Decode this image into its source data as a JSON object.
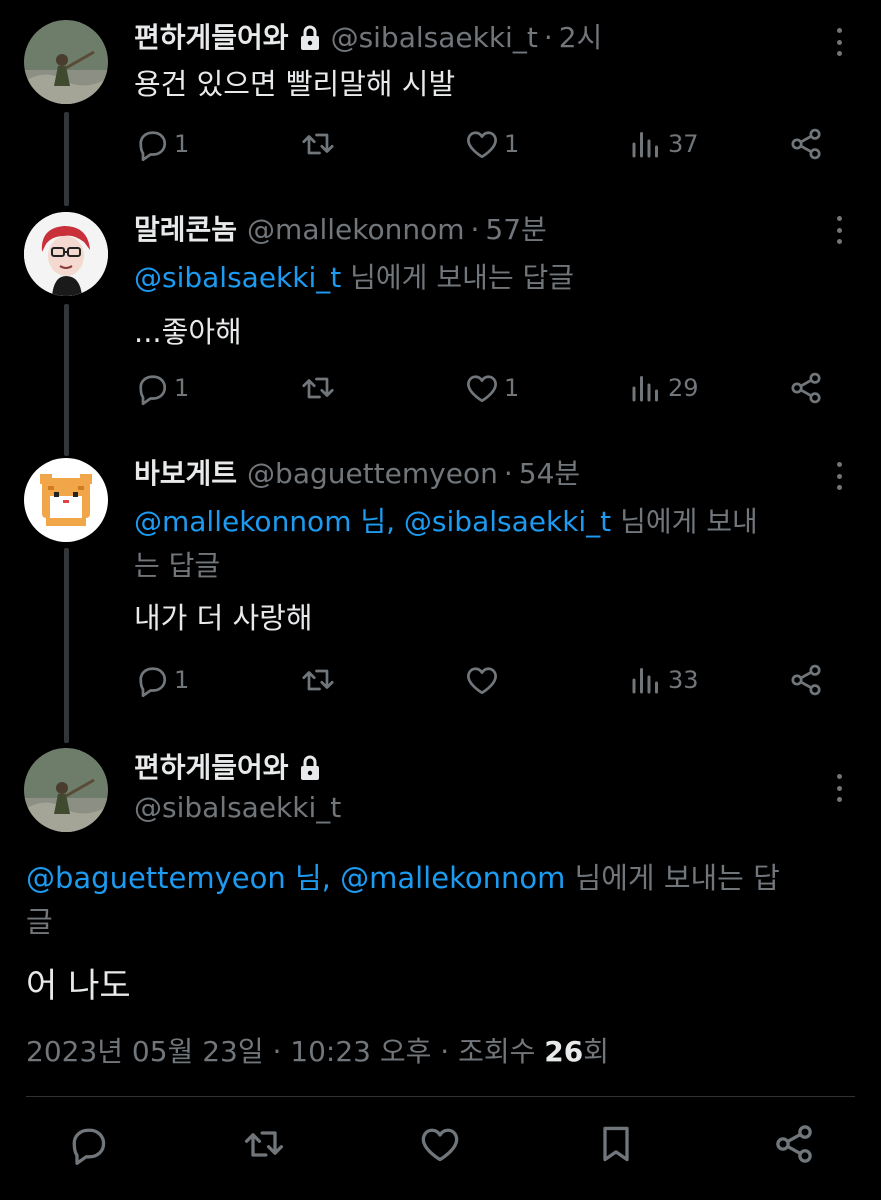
{
  "tweets": [
    {
      "name": "편하게들어와",
      "handle": "@sibalsaekki_t",
      "time": "2시",
      "reply_mentions": "",
      "reply_suffix": "",
      "reply_wrap": "",
      "text": "용건 있으면 빨리말해 시발",
      "replies": "1",
      "retweets": "",
      "likes": "1",
      "views": "37",
      "locked": true
    },
    {
      "name": "말레콘놈",
      "handle": "@mallekonnom",
      "time": "57분",
      "reply_mentions": "@sibalsaekki_t",
      "reply_suffix": " 님에게 보내는 답글",
      "reply_wrap": "",
      "text": "...좋아해",
      "replies": "1",
      "retweets": "",
      "likes": "1",
      "views": "29",
      "locked": false
    },
    {
      "name": "바보게트",
      "handle": "@baguettemyeon",
      "time": "54분",
      "reply_mentions": "@mallekonnom 님, @sibalsaekki_t",
      "reply_suffix": " 님에게 보내",
      "reply_wrap": "는 답글",
      "text": "내가 더 사랑해",
      "replies": "1",
      "retweets": "",
      "likes": "",
      "views": "33",
      "locked": false
    }
  ],
  "main": {
    "name": "편하게들어와",
    "handle": "@sibalsaekki_t",
    "reply_mentions": "@baguettemyeon 님, @mallekonnom",
    "reply_suffix": " 님에게 보내는 답",
    "reply_wrap": "글",
    "text": "어 나도",
    "date": "2023년 05월 23일 · 10:23 오후 · 조회수 ",
    "views": "26",
    "views_suffix": "회"
  },
  "colors": {
    "background": "#000000",
    "text": "#e7e9ea",
    "muted": "#71767b",
    "accent": "#1d9bf0"
  },
  "icons": {
    "reply": "reply-icon",
    "retweet": "retweet-icon",
    "like": "heart-icon",
    "views": "views-icon",
    "share": "share-icon",
    "bookmark": "bookmark-icon",
    "lock": "lock-icon"
  }
}
